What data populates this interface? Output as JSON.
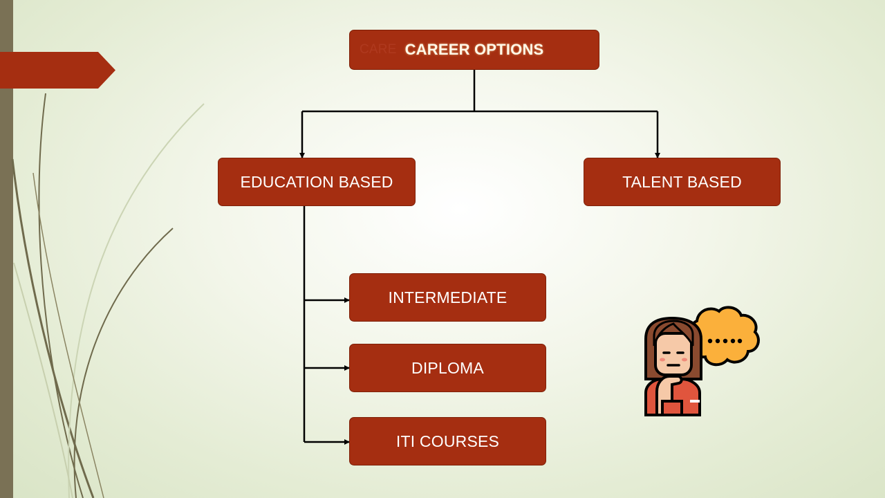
{
  "diagram": {
    "title": "CAREER OPTIONS",
    "ghost_text": "CARE",
    "branches": {
      "education": "EDUCATION BASED",
      "talent": "TALENT BASED"
    },
    "education_options": [
      "INTERMEDIATE",
      "DIPLOMA",
      "ITI COURSES"
    ]
  },
  "colors": {
    "box_fill": "#a52e11",
    "connector": "#000000",
    "accent_bar": "#7a7155",
    "thought_bubble": "#fbb03b"
  },
  "icons": {
    "illustration": "thinking-girl-icon",
    "bubble": "thought-bubble-icon"
  }
}
